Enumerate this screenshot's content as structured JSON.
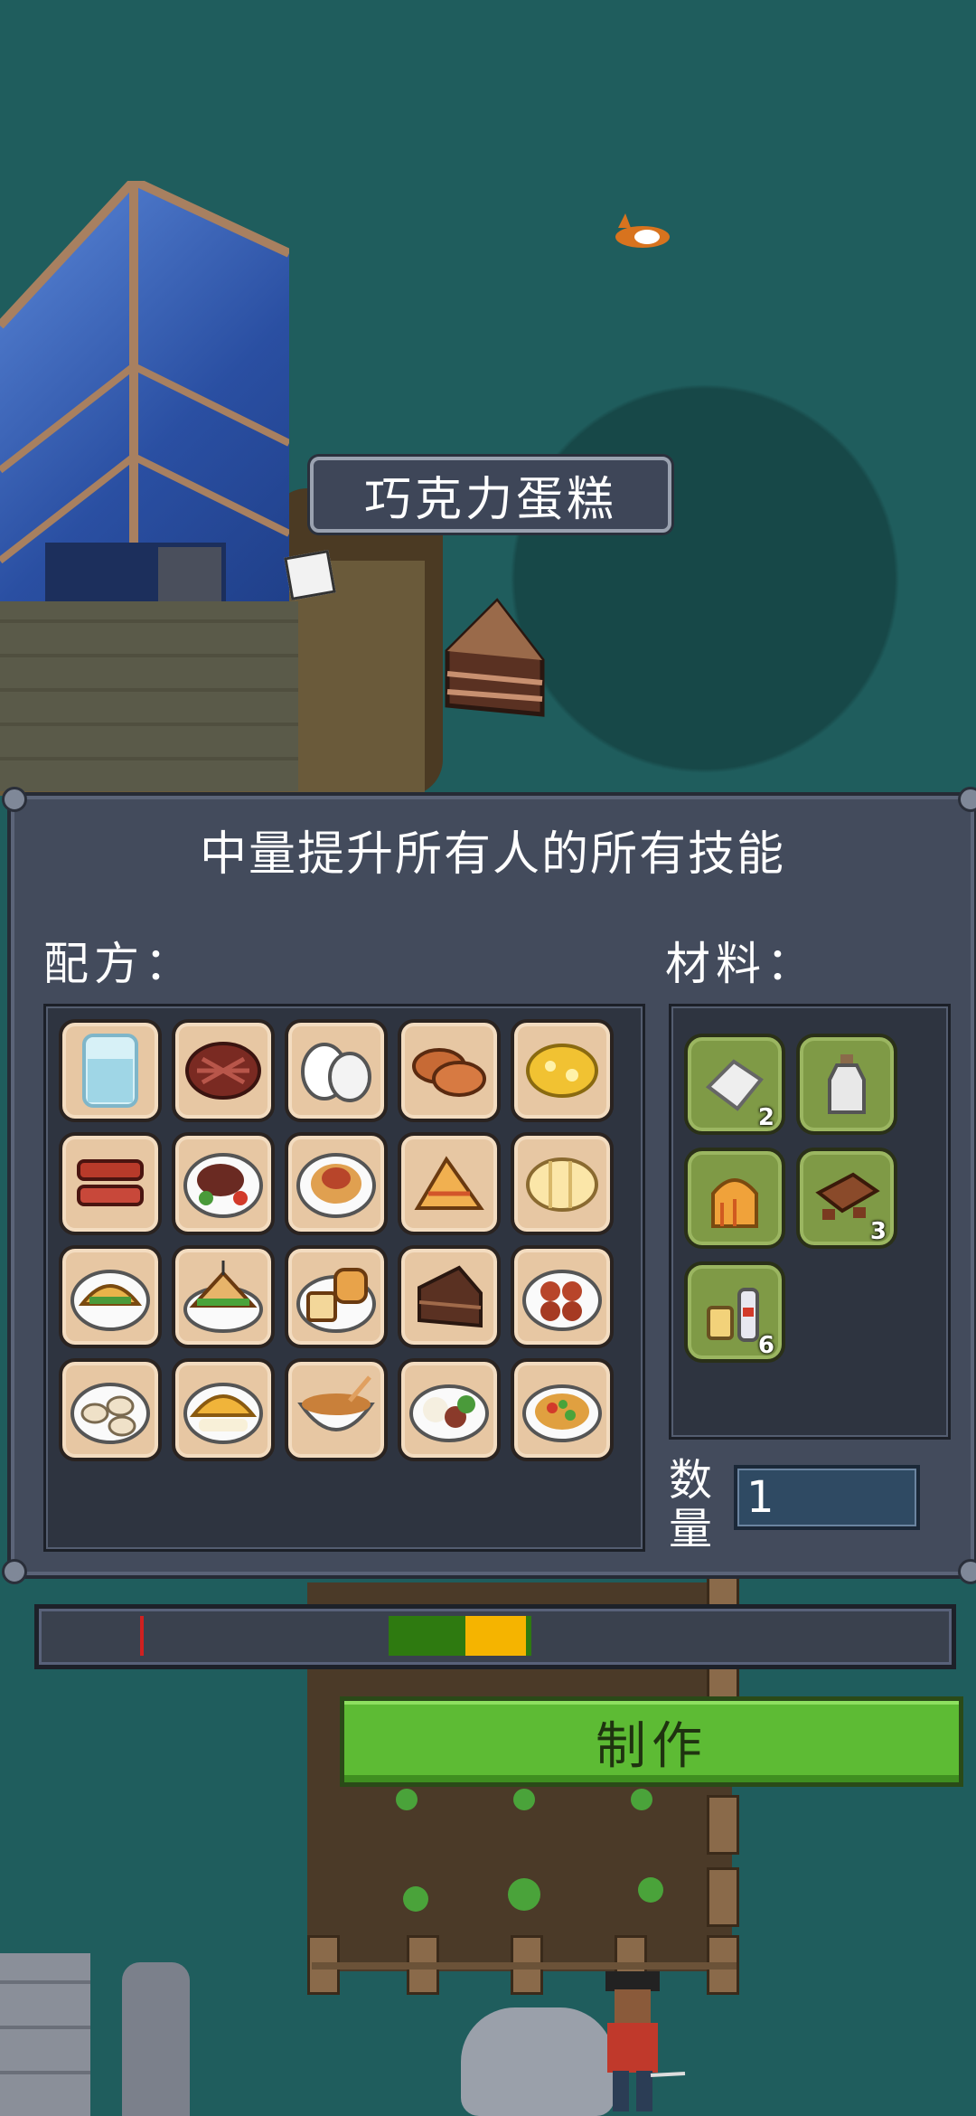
{
  "item_title": "巧克力蛋糕",
  "panel": {
    "description": "中量提升所有人的所有技能",
    "recipes_label": "配方：",
    "materials_label": "材料：",
    "quantity_label_line1": "数",
    "quantity_label_line2": "量",
    "quantity_value": "1"
  },
  "recipes": [
    {
      "name": "glass-of-water"
    },
    {
      "name": "steak"
    },
    {
      "name": "eggs"
    },
    {
      "name": "bread-loaves"
    },
    {
      "name": "scrambled-eggs"
    },
    {
      "name": "bacon"
    },
    {
      "name": "steak-plate"
    },
    {
      "name": "pasta-plate"
    },
    {
      "name": "toast-slices"
    },
    {
      "name": "cheese"
    },
    {
      "name": "taco-plate"
    },
    {
      "name": "sandwich-plate"
    },
    {
      "name": "bread-plate"
    },
    {
      "name": "chocolate-cake"
    },
    {
      "name": "meatballs-plate"
    },
    {
      "name": "dumplings-plate"
    },
    {
      "name": "omelette-plate"
    },
    {
      "name": "noodle-bowl"
    },
    {
      "name": "rice-plate"
    },
    {
      "name": "salad-plate"
    }
  ],
  "materials": [
    {
      "name": "flour-bag",
      "count": "2"
    },
    {
      "name": "milk-bottle",
      "count": ""
    },
    {
      "name": "sugar",
      "count": ""
    },
    {
      "name": "chocolate-bar",
      "count": "3"
    },
    {
      "name": "oil-and-condiments",
      "count": "6"
    }
  ],
  "timing_bar": {
    "marker_color": "#d02020",
    "success_color": "#2e7a10",
    "perfect_color": "#f5b400"
  },
  "craft_button_label": "制作"
}
